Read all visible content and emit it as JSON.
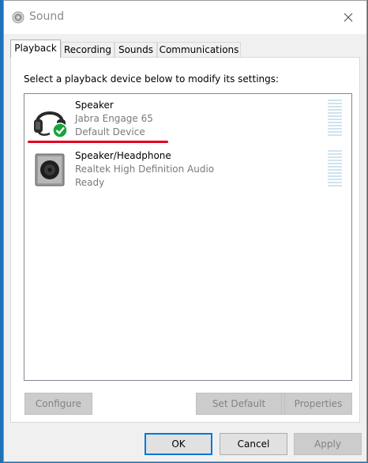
{
  "window": {
    "title": "Sound"
  },
  "tabs": [
    {
      "label": "Playback",
      "active": true
    },
    {
      "label": "Recording",
      "active": false
    },
    {
      "label": "Sounds",
      "active": false
    },
    {
      "label": "Communications",
      "active": false
    }
  ],
  "playback": {
    "instruction": "Select a playback device below to modify its settings:",
    "devices": [
      {
        "name": "Speaker",
        "description": "Jabra Engage 65",
        "status": "Default Device",
        "icon": "headset-icon",
        "is_default": true
      },
      {
        "name": "Speaker/Headphone",
        "description": "Realtek High Definition Audio",
        "status": "Ready",
        "icon": "speaker-icon",
        "is_default": false
      }
    ],
    "buttons": {
      "configure": "Configure",
      "set_default": "Set Default",
      "properties": "Properties"
    }
  },
  "footer": {
    "ok": "OK",
    "cancel": "Cancel",
    "apply": "Apply"
  },
  "colors": {
    "accent": "#0078d7",
    "annotation_red": "#e3001b",
    "check_green": "#1aa33c",
    "meter": "#cfe3ef"
  }
}
